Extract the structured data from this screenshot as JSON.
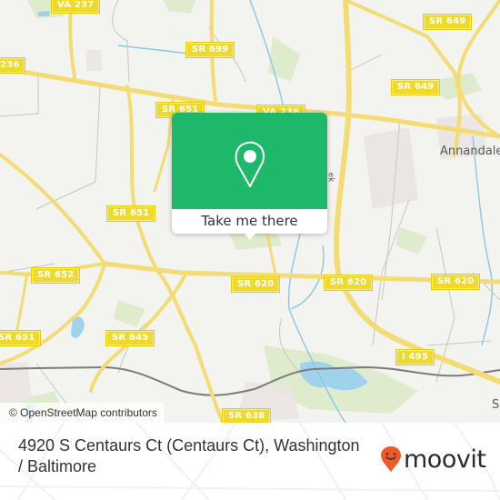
{
  "map": {
    "road_shields": [
      {
        "id": "va-237",
        "label": "VA 237"
      },
      {
        "id": "sr-699",
        "label": "SR 699"
      },
      {
        "id": "va-236-west",
        "label": "236"
      },
      {
        "id": "sr-651-north",
        "label": "SR 651"
      },
      {
        "id": "va-236",
        "label": "VA 236"
      },
      {
        "id": "sr-649-north",
        "label": "SR 649"
      },
      {
        "id": "sr-649",
        "label": "SR 649"
      },
      {
        "id": "sr-651-mid",
        "label": "SR 651"
      },
      {
        "id": "sr-652",
        "label": "SR 652"
      },
      {
        "id": "sr-620-west",
        "label": "SR 620"
      },
      {
        "id": "sr-620-mid",
        "label": "SR 620"
      },
      {
        "id": "sr-620-east",
        "label": "SR 620"
      },
      {
        "id": "sr-651-south",
        "label": "SR 651"
      },
      {
        "id": "sr-645",
        "label": "SR 645"
      },
      {
        "id": "i-495",
        "label": "I 495"
      },
      {
        "id": "sr-638",
        "label": "SR 638"
      }
    ],
    "place_labels": [
      {
        "id": "annandale",
        "label": "Annandale"
      },
      {
        "id": "edge-s",
        "label": "S"
      },
      {
        "id": "creek",
        "label": "ek"
      }
    ],
    "attribution": "© OpenStreetMap contributors"
  },
  "popup": {
    "icon": "map-pin-icon",
    "button_label": "Take me there",
    "accent_color": "#1eb86a"
  },
  "footer": {
    "address": "4920 S Centaurs Ct (Centaurs Ct), Washington / Baltimore",
    "brand": "moovit",
    "brand_color": "#f05a28"
  }
}
